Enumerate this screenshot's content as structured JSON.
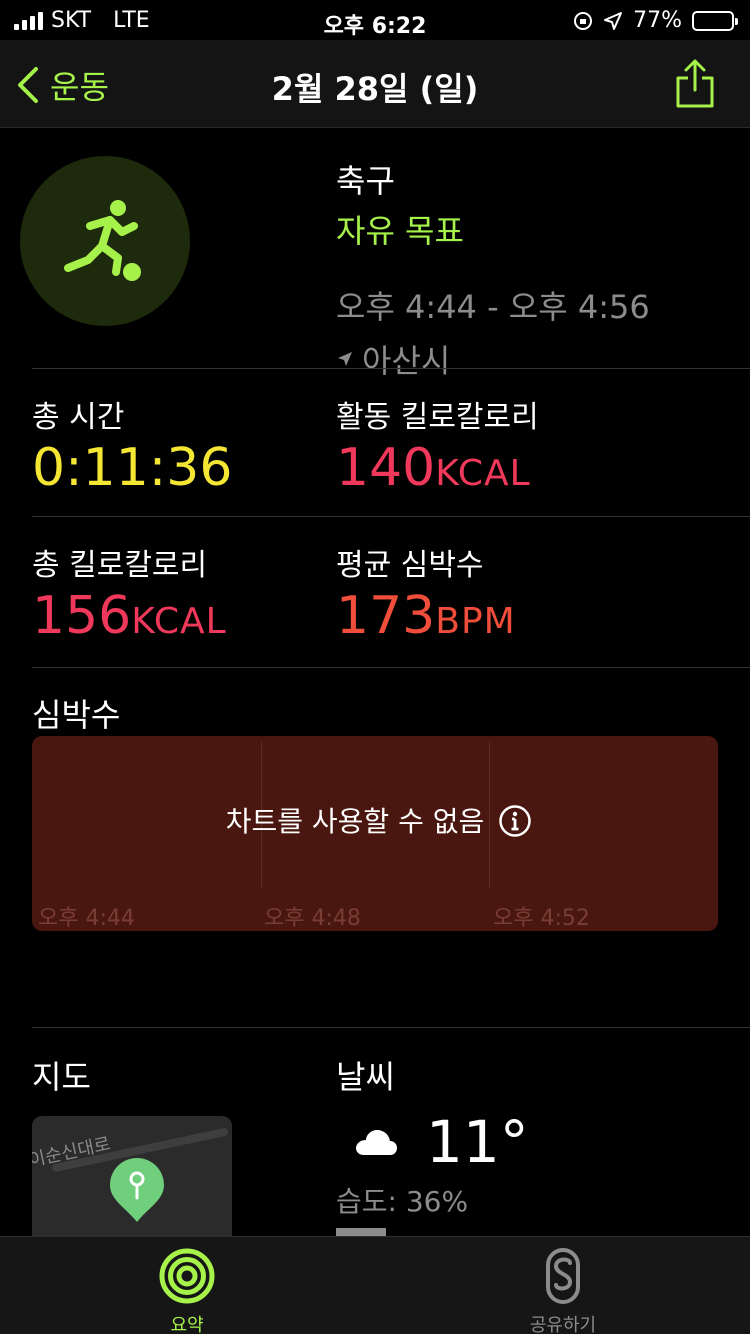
{
  "status_bar": {
    "carrier": "SKT",
    "network": "LTE",
    "time": "오후 6:22",
    "battery": "77%",
    "battery_level": 0.77
  },
  "nav": {
    "back_label": "운동",
    "title": "2월 28일 (일)",
    "share_icon": "share-icon"
  },
  "workout": {
    "icon": "soccer-player-icon",
    "name": "축구",
    "goal": "자유 목표",
    "time_range": "오후 4:44 - 오후 4:56",
    "location": "아산시"
  },
  "stats": {
    "total_time": {
      "label": "총 시간",
      "value": "0:11:36",
      "color": "#f5e634"
    },
    "active_cal": {
      "label": "활동 킬로칼로리",
      "value": "140",
      "unit": "KCAL",
      "color": "#f0395a"
    },
    "total_cal": {
      "label": "총 킬로칼로리",
      "value": "156",
      "unit": "KCAL",
      "color": "#f0395a"
    },
    "avg_hr": {
      "label": "평균 심박수",
      "value": "173",
      "unit": "BPM",
      "color": "#f04e3a"
    }
  },
  "heart_rate": {
    "title": "심박수",
    "unavailable": "차트를 사용할 수 없음",
    "ticks": [
      "오후 4:44",
      "오후 4:48",
      "오후 4:52"
    ]
  },
  "map": {
    "title": "지도",
    "road_name": "이순신대로"
  },
  "weather": {
    "title": "날씨",
    "icon": "cloud-icon",
    "temperature": "11°",
    "humidity": "습도: 36%"
  },
  "tabs": [
    {
      "label": "요약",
      "icon": "activity-rings-icon",
      "active": true,
      "color": "#a6f24a"
    },
    {
      "label": "공유하기",
      "icon": "sharing-icon",
      "active": false,
      "color": "#8c8c8c"
    }
  ]
}
